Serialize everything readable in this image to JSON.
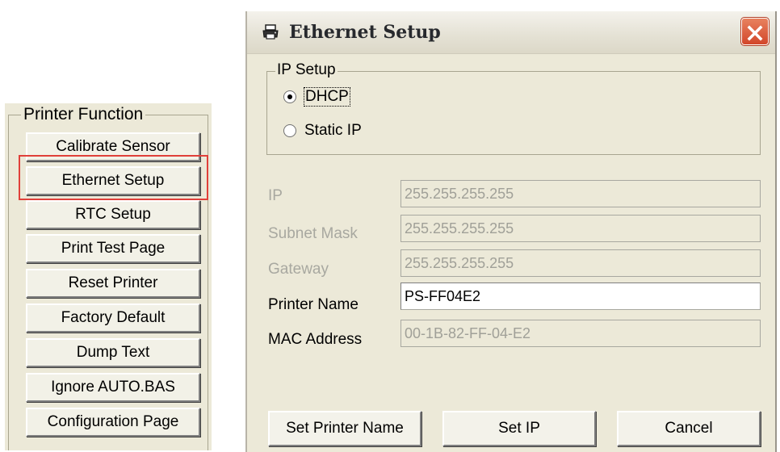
{
  "printer_function": {
    "group_label": "Printer Function",
    "buttons": [
      {
        "label": "Calibrate Sensor"
      },
      {
        "label": "Ethernet Setup",
        "highlighted": true
      },
      {
        "label": "RTC Setup"
      },
      {
        "label": "Print Test Page"
      },
      {
        "label": "Reset Printer"
      },
      {
        "label": "Factory Default"
      },
      {
        "label": "Dump Text"
      },
      {
        "label": "Ignore AUTO.BAS"
      },
      {
        "label": "Configuration Page"
      }
    ],
    "highlight_color": "#e0403a"
  },
  "dialog": {
    "title": "Ethernet Setup",
    "title_icon": "printer-icon",
    "close_icon": "close-icon",
    "ip_setup": {
      "group_label": "IP Setup",
      "options": [
        {
          "label": "DHCP",
          "selected": true
        },
        {
          "label": "Static IP",
          "selected": false
        }
      ]
    },
    "fields": {
      "ip": {
        "label": "IP",
        "value": "255.255.255.255",
        "enabled": false
      },
      "subnet_mask": {
        "label": "Subnet Mask",
        "value": "255.255.255.255",
        "enabled": false
      },
      "gateway": {
        "label": "Gateway",
        "value": "255.255.255.255",
        "enabled": false
      },
      "printer_name": {
        "label": "Printer Name",
        "value": "PS-FF04E2",
        "enabled": true
      },
      "mac_address": {
        "label": "MAC Address",
        "value": "00-1B-82-FF-04-E2",
        "enabled": false
      }
    },
    "buttons": {
      "set_printer_name": "Set Printer Name",
      "set_ip": "Set IP",
      "cancel": "Cancel"
    }
  },
  "colors": {
    "window_face": "#ece9d8",
    "close_button": "#d2462a",
    "disabled_text": "#a8a8a0"
  }
}
